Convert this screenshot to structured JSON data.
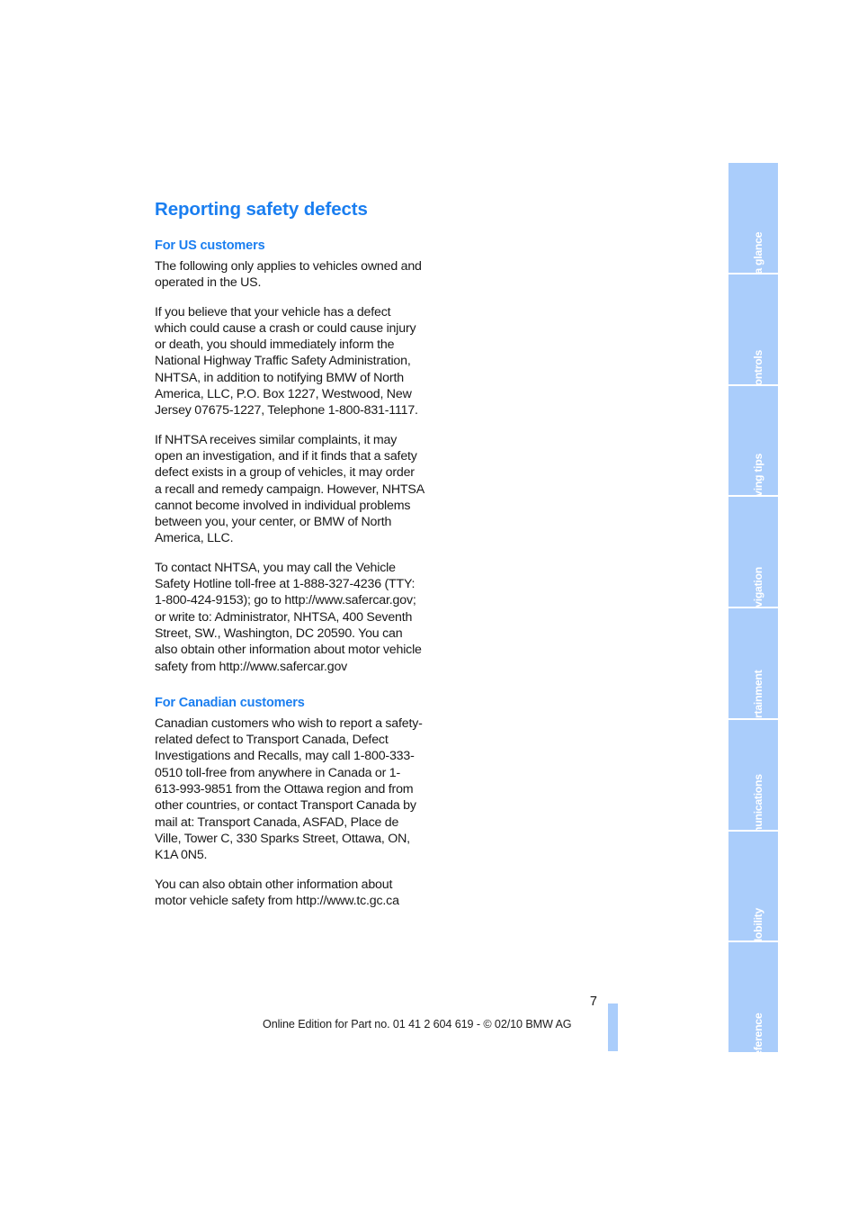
{
  "document": {
    "page_number": "7",
    "footer_note": "Online Edition for Part no. 01 41 2 604 619 - © 02/10 BMW AG"
  },
  "colors": {
    "heading_blue": "#1a7ef0",
    "tab_blue": "#aacdfb",
    "body_text": "#181818",
    "page_background": "#ffffff"
  },
  "main": {
    "title": "Reporting safety defects",
    "sections": [
      {
        "heading": "For US customers",
        "paragraphs": [
          "The following only applies to vehicles owned and operated in the US.",
          "If you believe that your vehicle has a defect which could cause a crash or could cause injury or death, you should immediately inform the National Highway Traffic Safety Administration, NHTSA, in addition to notifying BMW of North America, LLC, P.O. Box 1227, Westwood, New Jersey 07675-1227, Telephone 1-800-831-1117.",
          "If NHTSA receives similar complaints, it may open an investigation, and if it finds that a safety defect exists in a group of vehicles, it may order a recall and remedy campaign. However, NHTSA cannot become involved in individual problems between you, your center, or BMW of North America, LLC.",
          "To contact NHTSA, you may call the Vehicle Safety Hotline toll-free at 1-888-327-4236 (TTY: 1-800-424-9153); go to http://www.safercar.gov; or write to: Administrator, NHTSA, 400 Seventh Street, SW., Washington, DC 20590. You can also obtain other information about motor vehicle safety from http://www.safercar.gov"
        ]
      },
      {
        "heading": "For Canadian customers",
        "paragraphs": [
          "Canadian customers who wish to report a safety-related defect to Transport Canada, Defect Investigations and Recalls, may call 1-800-333-0510 toll-free from anywhere in Canada or 1-613-993-9851 from the Ottawa region and from other countries, or contact Transport Canada by mail at: Transport Canada, ASFAD, Place de Ville, Tower C, 330 Sparks Street, Ottawa, ON, K1A 0N5.",
          "You can also obtain other information about motor vehicle safety from http://www.tc.gc.ca"
        ]
      }
    ]
  },
  "tabs": [
    {
      "label": "At a glance"
    },
    {
      "label": "Controls"
    },
    {
      "label": "Driving tips"
    },
    {
      "label": "Navigation"
    },
    {
      "label": "Entertainment"
    },
    {
      "label": "Communications"
    },
    {
      "label": "Mobility"
    },
    {
      "label": "Reference"
    }
  ]
}
